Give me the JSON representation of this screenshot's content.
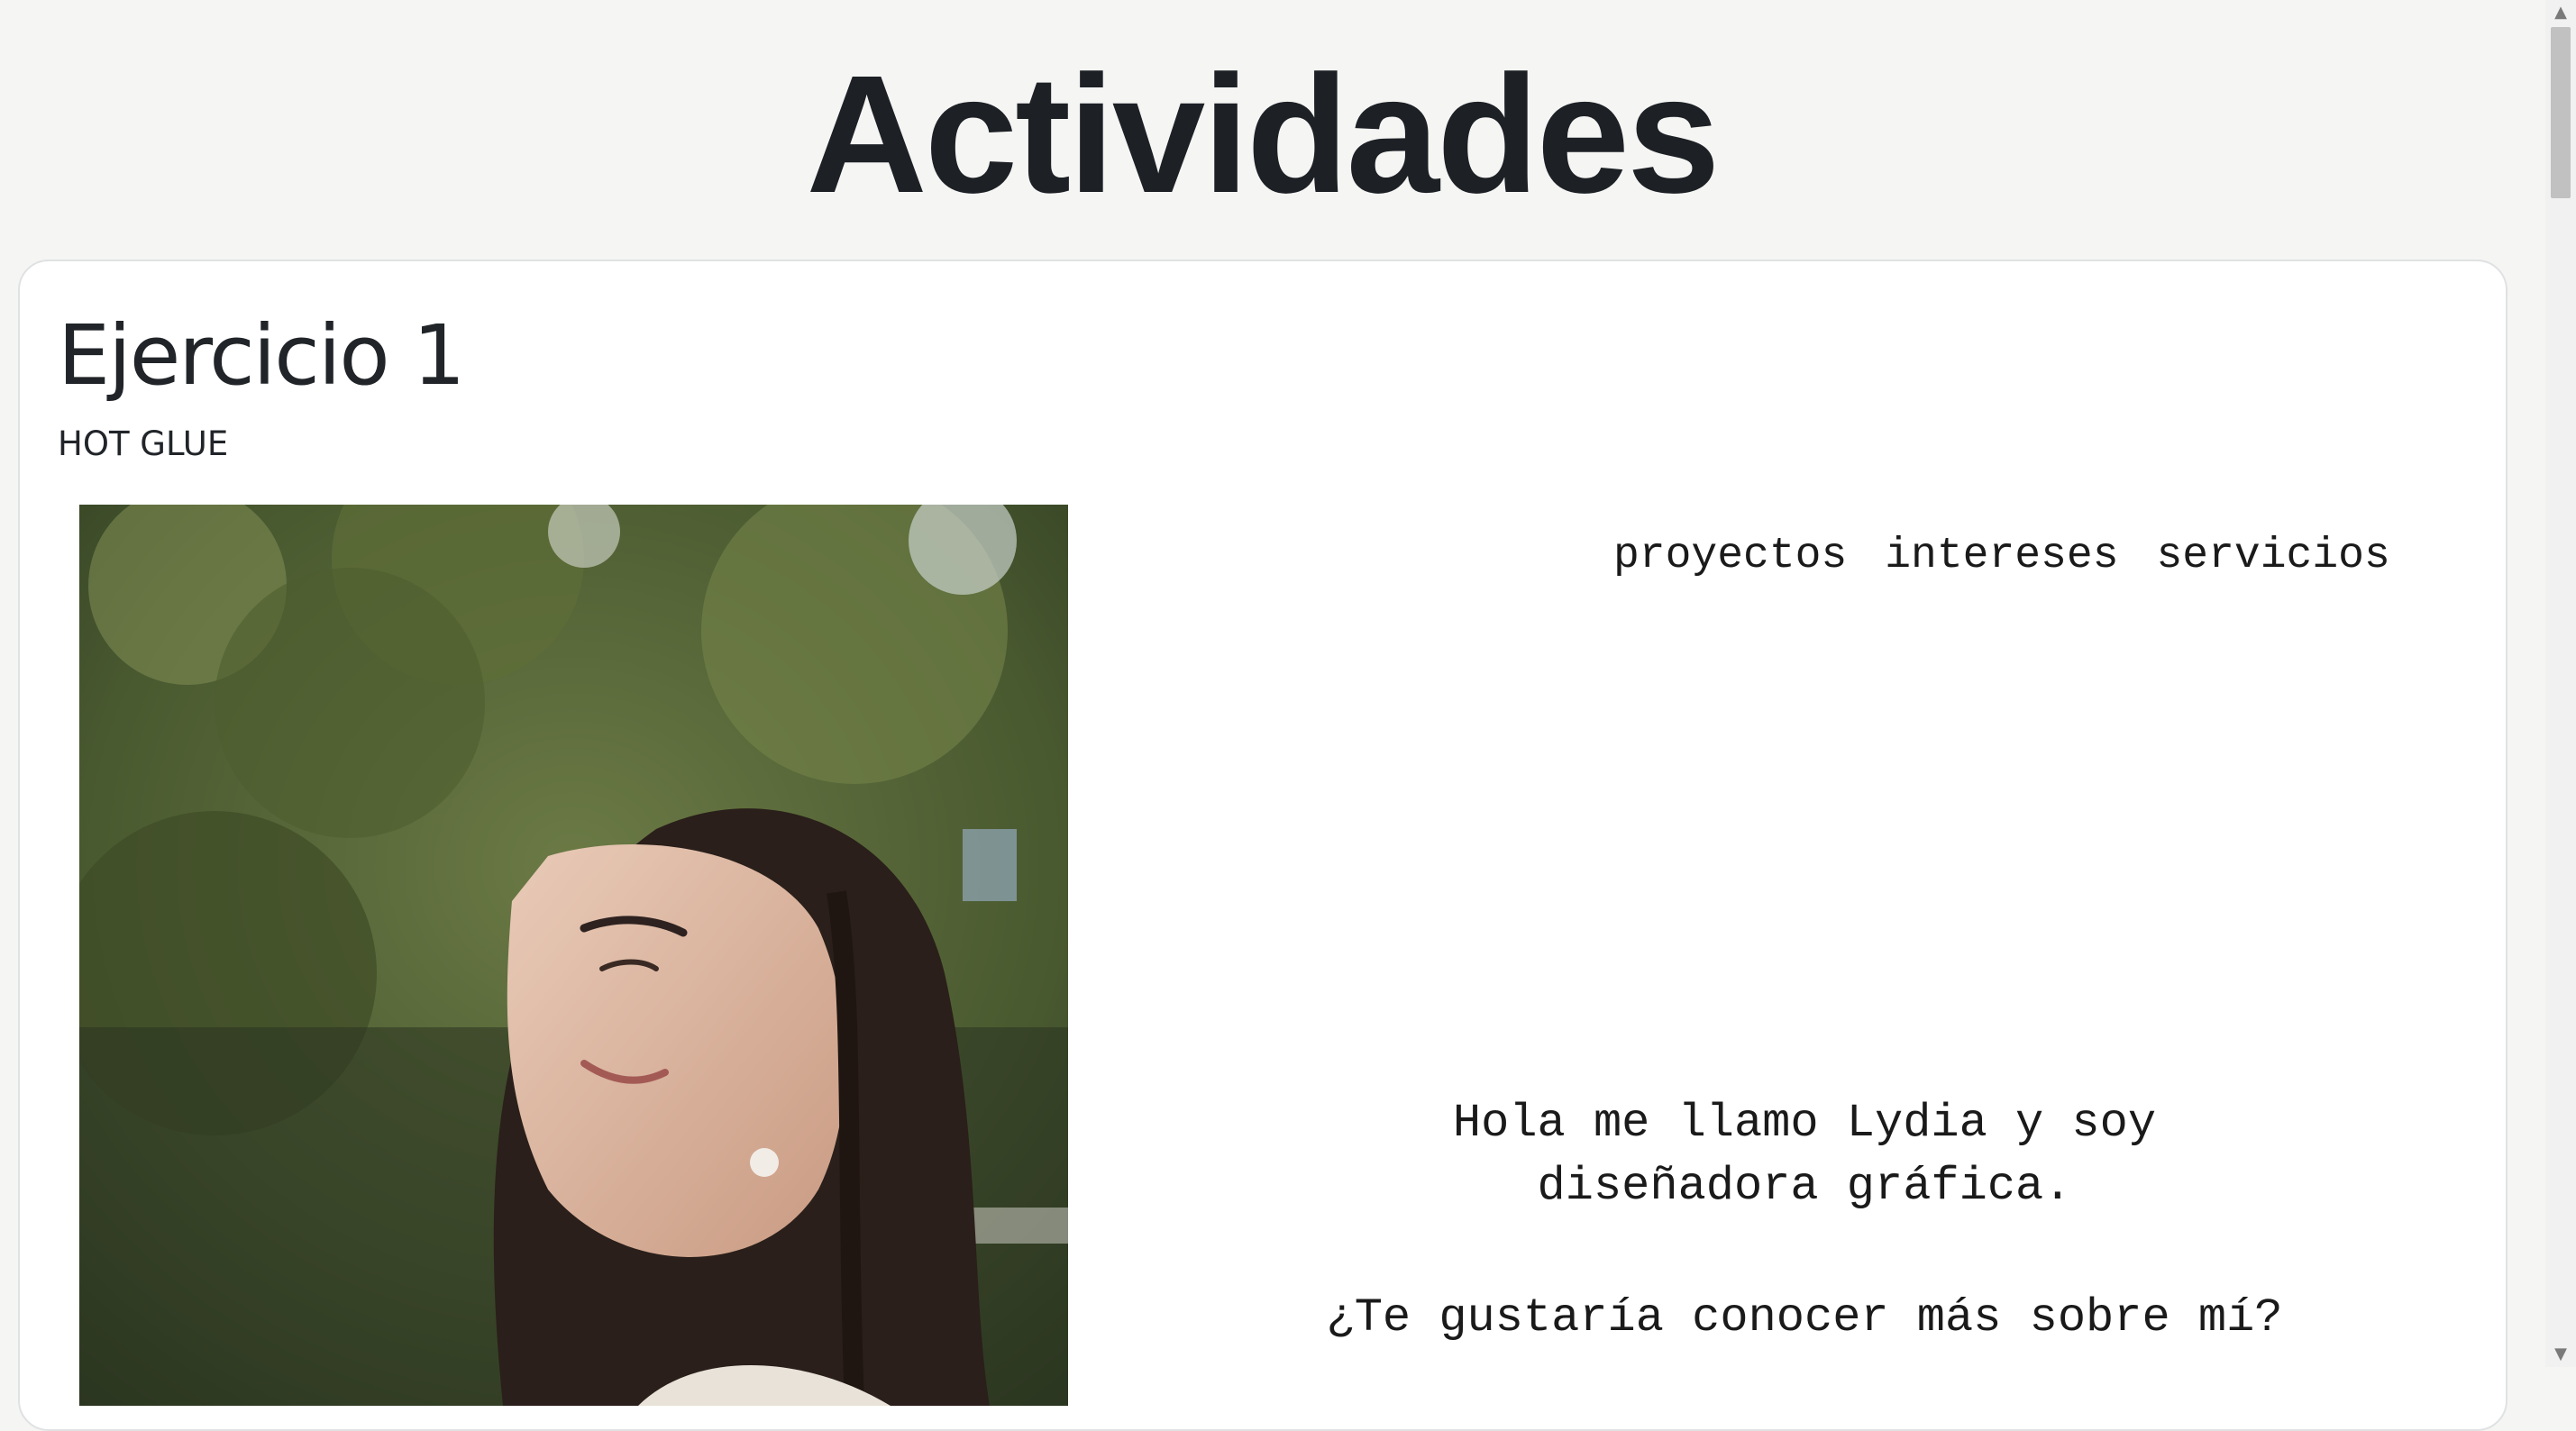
{
  "page": {
    "title": "Actividades"
  },
  "exercise": {
    "title": "Ejercicio 1",
    "subtitle": "HOT GLUE",
    "photo": "portrait-photo",
    "nav": [
      {
        "label": "proyectos"
      },
      {
        "label": "intereses"
      },
      {
        "label": "servicios"
      }
    ],
    "intro_line1": "Hola me llamo Lydia y soy",
    "intro_line2": "diseñadora gráfica.",
    "question": "¿Te gustaría conocer más sobre mí?"
  },
  "scrollbar": {
    "up_icon": "▲",
    "down_icon": "▼"
  },
  "colors": {
    "background": "#f5f5f3",
    "card": "#ffffff",
    "text": "#212529"
  }
}
